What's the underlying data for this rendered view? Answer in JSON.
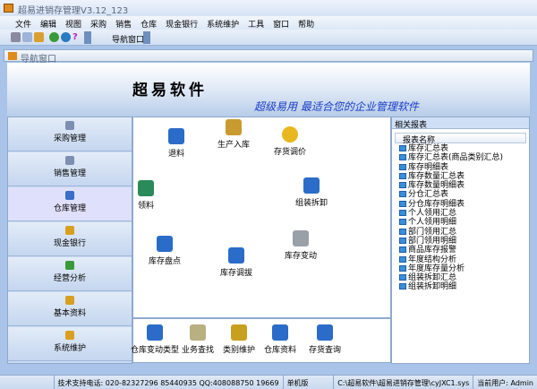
{
  "app": {
    "title": "超易进销存管理V3.12_123"
  },
  "menu": [
    "文件",
    "编辑",
    "视图",
    "采购",
    "销售",
    "仓库",
    "现金银行",
    "系统维护",
    "工具",
    "窗口",
    "帮助"
  ],
  "toolbar": {
    "nav_button": "导航窗口",
    "icons": [
      "cut-icon",
      "copy-icon",
      "paste-icon",
      "refresh-icon",
      "globe-icon",
      "help-icon"
    ]
  },
  "navwindow": {
    "title": "导航窗口"
  },
  "banner": {
    "title": "超易软件",
    "slogan": "超级易用 最适合您的企业管理软件"
  },
  "sidebar": {
    "selected": "仓库管理",
    "items": [
      "采购管理",
      "销售管理",
      "仓库管理",
      "现金银行",
      "经营分析",
      "基本资料",
      "系统维护"
    ]
  },
  "center": {
    "items": [
      "退料",
      "生产入库",
      "存货调价",
      "领料",
      "组装拆卸",
      "库存盘点",
      "库存调拔",
      "库存变动"
    ]
  },
  "bottom": {
    "items": [
      "仓库变动类型",
      "业务查找",
      "类别维护",
      "仓库资料",
      "存货查询"
    ]
  },
  "reports": {
    "title": "相关报表",
    "column": "报表名称",
    "items": [
      "库存汇总表",
      "库存汇总表(商品类别汇总)",
      "库存明细表",
      "库存数量汇总表",
      "库存数量明细表",
      "分仓汇总表",
      "分仓库存明细表",
      "个人领用汇总",
      "个人领用明细",
      "部门领用汇总",
      "部门领用明细",
      "商品库存报警",
      "年度结构分析",
      "年度库存量分析",
      "组装拆卸汇总",
      "组装拆卸明细"
    ]
  },
  "status": {
    "support": "技术支持电话: 020-82327296 85440935 QQ:408088750 19669",
    "edition": "单机版",
    "path": "C:\\超易软件\\超易进销存管理\\cyJXC1.sys",
    "user": "当前用户: Admin"
  }
}
